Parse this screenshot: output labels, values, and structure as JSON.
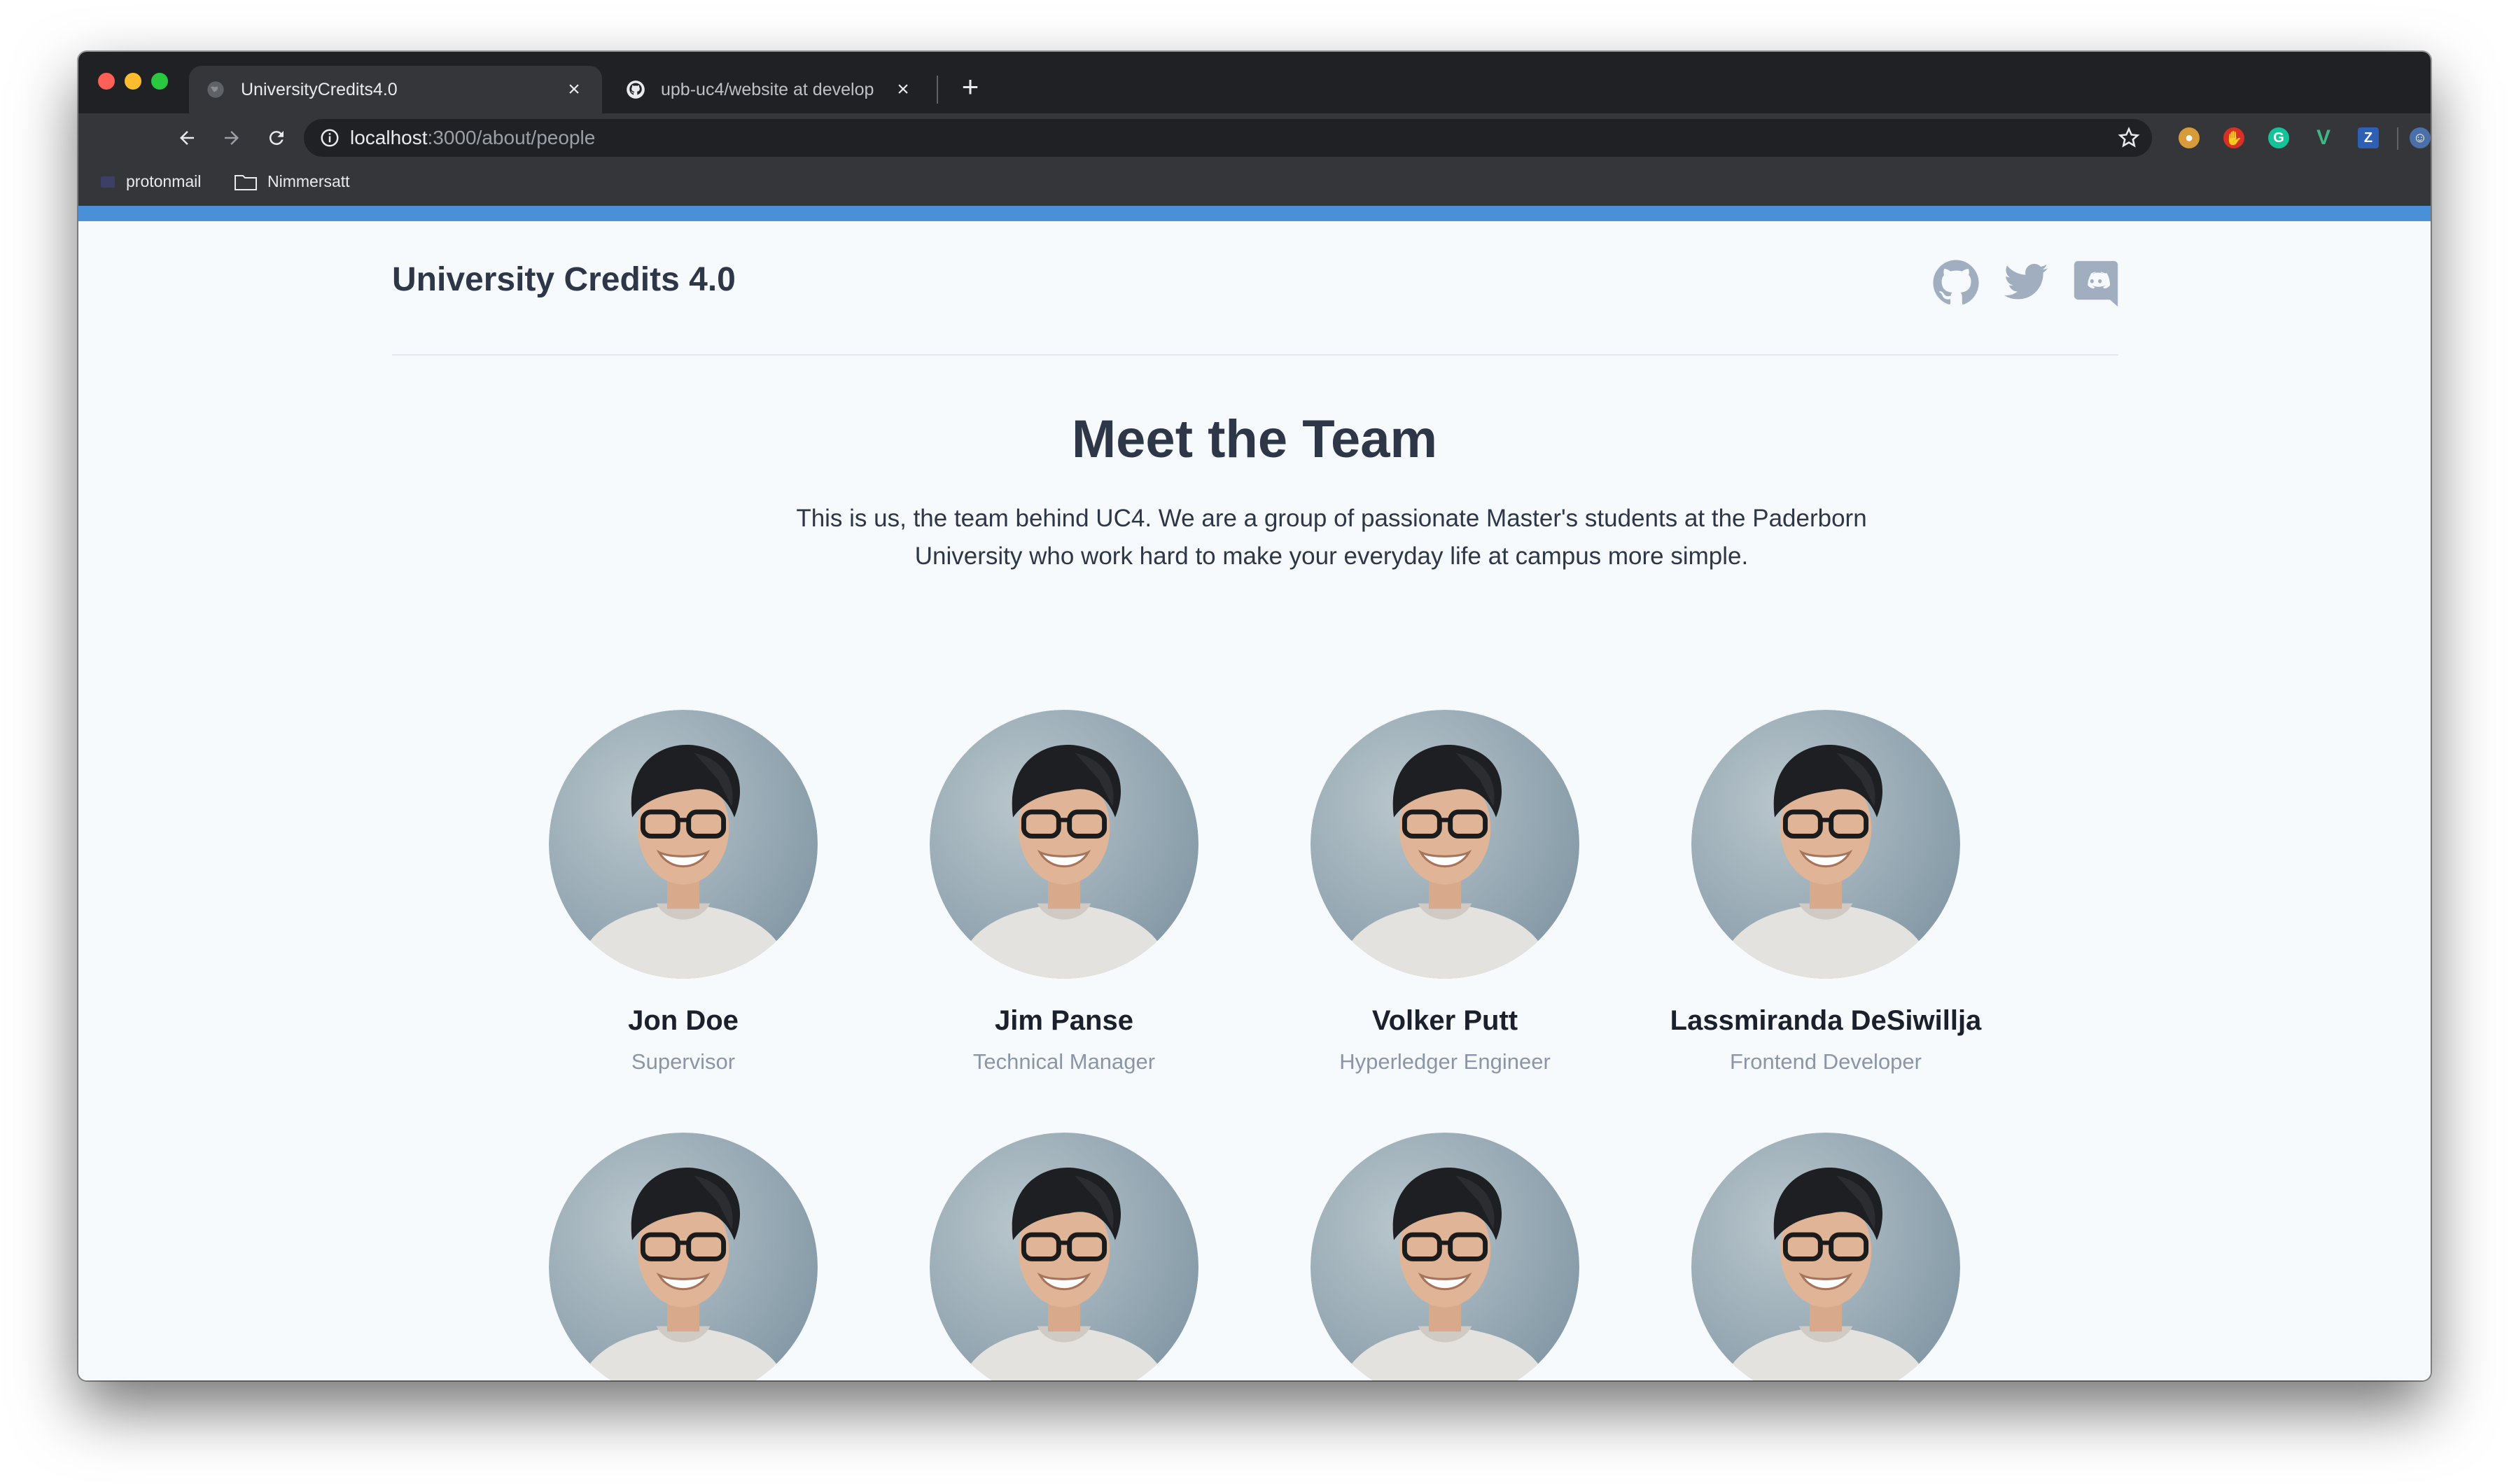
{
  "browser": {
    "tabs": [
      {
        "title": "UniversityCredits4.0",
        "active": true
      },
      {
        "title": "upb-uc4/website at develop",
        "active": false
      }
    ],
    "address": {
      "host": "localhost",
      "path": ":3000/about/people"
    },
    "bookmarks": [
      "protonmail",
      "Nimmersatt"
    ],
    "extensions": [
      "cookie-icon",
      "stop-icon",
      "grammarly-icon",
      "vue-icon",
      "zotero-icon",
      "profile-icon"
    ]
  },
  "site": {
    "title": "University Credits 4.0",
    "social": [
      "github-icon",
      "twitter-icon",
      "discord-icon"
    ],
    "accent": "#4a90d9"
  },
  "team": {
    "heading": "Meet the Team",
    "intro": "This is us, the team behind UC4. We are a group of passionate Master's students at the Paderborn University who work hard to make your everyday life at campus more simple.",
    "members": [
      {
        "name": "Jon Doe",
        "role": "Supervisor"
      },
      {
        "name": "Jim Panse",
        "role": "Technical Manager"
      },
      {
        "name": "Volker Putt",
        "role": "Hyperledger Engineer"
      },
      {
        "name": "Lassmiranda DeSiwillja",
        "role": "Frontend Developer"
      },
      {
        "name": "",
        "role": ""
      },
      {
        "name": "",
        "role": ""
      },
      {
        "name": "",
        "role": ""
      },
      {
        "name": "",
        "role": ""
      }
    ]
  }
}
